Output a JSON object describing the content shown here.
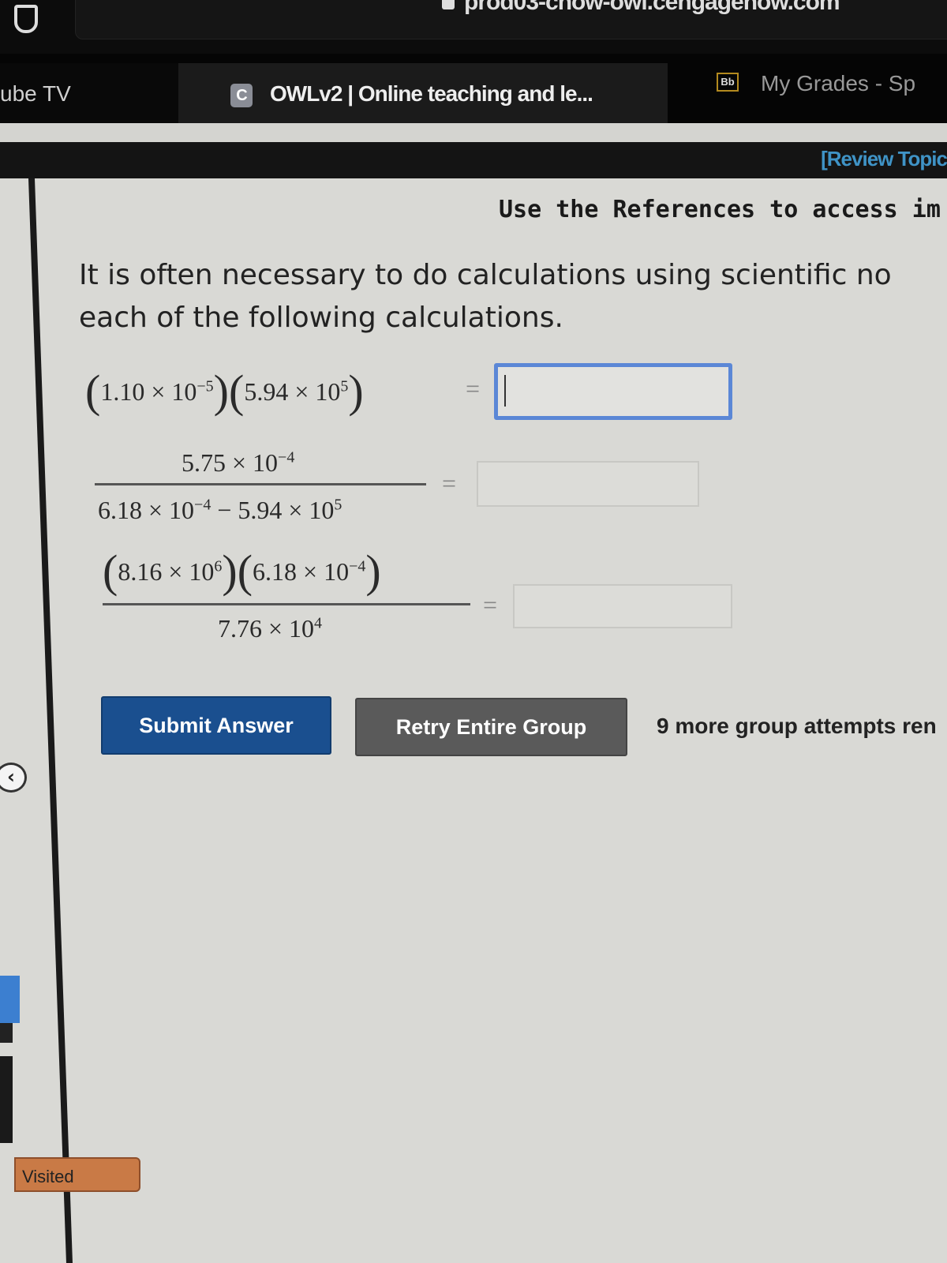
{
  "browser": {
    "url": "prod03-cnow-owl.cengagenow.com",
    "tabs": [
      {
        "label": "ube TV",
        "active": false
      },
      {
        "label": "OWLv2 | Online teaching and le...",
        "favicon": "C",
        "active": true
      },
      {
        "label": "My Grades - Sp",
        "favicon": "Bb",
        "active": false
      }
    ]
  },
  "header": {
    "review_link": "[Review Topic"
  },
  "content": {
    "references_note": "Use the References to access im",
    "intro_line1": "It is often necessary to do calculations using scientific no",
    "intro_line2": "each of the following calculations.",
    "problems": [
      {
        "expr_a": "1.10 × 10",
        "exp_a": "−5",
        "expr_b": "5.94 × 10",
        "exp_b": "5",
        "answer": ""
      },
      {
        "num": "5.75 × 10",
        "num_exp": "−4",
        "den_a": "6.18 × 10",
        "den_a_exp": "−4",
        "den_b": " − 5.94 × 10",
        "den_b_exp": "5",
        "answer": ""
      },
      {
        "num_a": "8.16 × 10",
        "num_a_exp": "6",
        "num_b": "6.18 × 10",
        "num_b_exp": "−4",
        "den": "7.76 × 10",
        "den_exp": "4",
        "answer": ""
      }
    ],
    "equals": "=",
    "submit_label": "Submit Answer",
    "retry_label": "Retry Entire Group",
    "attempts_text": "9 more group attempts ren"
  },
  "sidebar": {
    "visited_label": "Visited"
  },
  "colors": {
    "submit": "#1a4f8f",
    "retry": "#5a5a5a",
    "focus": "#5b87d6",
    "review_link": "#3f93c6",
    "visited": "#c97a46"
  }
}
